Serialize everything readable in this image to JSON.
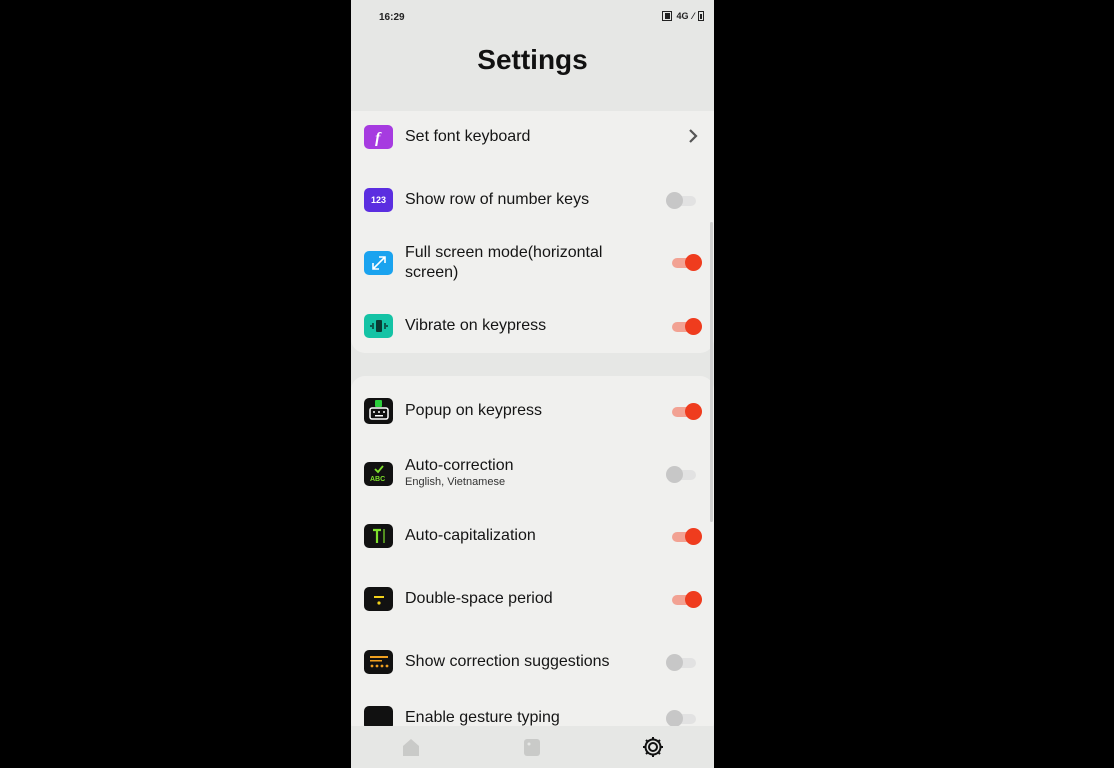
{
  "status": {
    "time": "16:29",
    "network": "4G"
  },
  "page": {
    "title": "Settings"
  },
  "group1": [
    {
      "label": "Set font keyboard",
      "icon": "font-icon",
      "control": "chevron",
      "icon_bg": "#a63be0"
    },
    {
      "label": "Show row of number keys",
      "icon": "number-123-icon",
      "icon_text": "123",
      "control": "toggle",
      "state": "off",
      "icon_bg": "#5b2ee0"
    },
    {
      "label": "Full screen mode(horizontal screen)",
      "icon": "expand-arrows-icon",
      "control": "toggle",
      "state": "on",
      "icon_bg": "#1aa3ef"
    },
    {
      "label": "Vibrate on keypress",
      "icon": "vibrate-icon",
      "control": "toggle",
      "state": "on",
      "icon_bg": "#14c3a5"
    }
  ],
  "group2": [
    {
      "label": "Popup on keypress",
      "icon": "keyboard-popup-icon",
      "control": "toggle",
      "state": "on",
      "icon_bg": "#111111"
    },
    {
      "label": "Auto-correction",
      "sublabel": "English, Vietnamese",
      "icon": "abc-check-icon",
      "control": "toggle",
      "state": "off",
      "icon_bg": "#111111"
    },
    {
      "label": "Auto-capitalization",
      "icon": "text-cursor-icon",
      "control": "toggle",
      "state": "on",
      "icon_bg": "#111111"
    },
    {
      "label": "Double-space period",
      "icon": "period-icon",
      "control": "toggle",
      "state": "on",
      "icon_bg": "#111111"
    },
    {
      "label": "Show correction suggestions",
      "icon": "suggested-words-icon",
      "control": "toggle",
      "state": "off",
      "icon_bg": "#111111"
    },
    {
      "label": "Enable gesture typing",
      "icon": "gesture-icon",
      "control": "toggle",
      "state": "off",
      "icon_bg": "#111111"
    }
  ],
  "navbar": [
    {
      "name": "home-icon"
    },
    {
      "name": "theme-icon"
    },
    {
      "name": "gear-icon",
      "active": true
    }
  ],
  "colors": {
    "toggle_on": "#ef3c1e",
    "toggle_on_track": "#f2a293",
    "background": "#e6e7e5"
  }
}
